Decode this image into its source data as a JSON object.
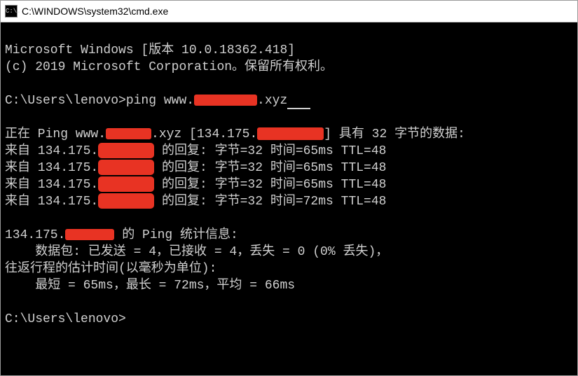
{
  "window": {
    "title": "C:\\WINDOWS\\system32\\cmd.exe",
    "icon_label": "C:\\."
  },
  "lines": {
    "l1": "Microsoft Windows [版本 10.0.18362.418]",
    "l2": "(c) 2019 Microsoft Corporation。保留所有权利。",
    "l4a": "C:\\Users\\lenovo>ping www.",
    "l4b": ".xyz",
    "l6a": "正在 Ping www.",
    "l6b": ".xyz [134.175.",
    "l6c": "] 具有 32 字节的数据:",
    "r1a": "来自 134.175.",
    "r1b": " 的回复: 字节=32 时间=65ms TTL=48",
    "r2a": "来自 134.175.",
    "r2b": " 的回复: 字节=32 时间=65ms TTL=48",
    "r3a": "来自 134.175.",
    "r3b": " 的回复: 字节=32 时间=65ms TTL=48",
    "r4a": "来自 134.175.",
    "r4b": " 的回复: 字节=32 时间=72ms TTL=48",
    "s1a": "134.175.",
    "s1b": " 的 Ping 统计信息:",
    "s2": "    数据包: 已发送 = 4，已接收 = 4，丢失 = 0 (0% 丢失)，",
    "s3": "往返行程的估计时间(以毫秒为单位):",
    "s4": "    最短 = 65ms，最长 = 72ms，平均 = 66ms",
    "p2": "C:\\Users\\lenovo>"
  }
}
